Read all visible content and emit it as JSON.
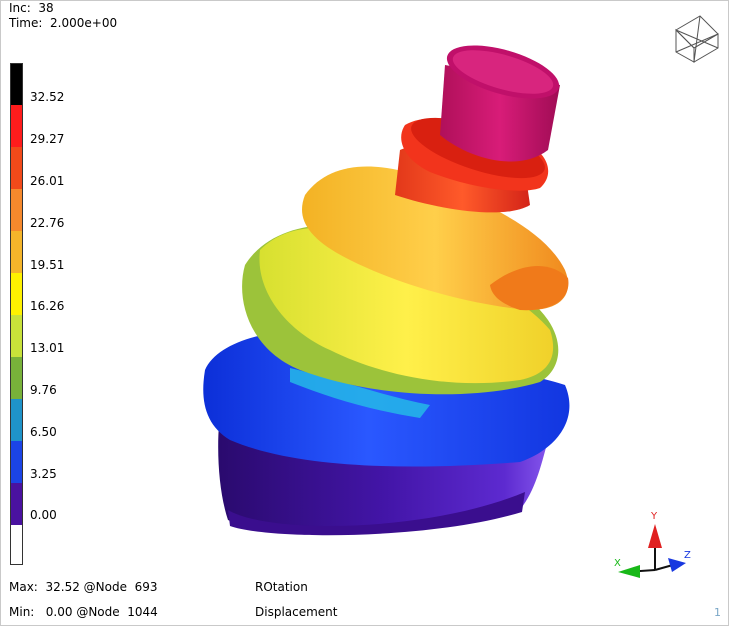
{
  "header": {
    "inc": "Inc:  38",
    "time": "Time:  2.000e+00"
  },
  "legend": {
    "ticks": [
      "32.52",
      "29.27",
      "26.01",
      "22.76",
      "19.51",
      "16.26",
      "13.01",
      "9.76",
      "6.50",
      "3.25",
      "0.00"
    ],
    "colors": [
      "#000000",
      "#ff1c1c",
      "#f24a1a",
      "#f6892c",
      "#f5b52a",
      "#fff200",
      "#c8e23a",
      "#78b23a",
      "#1f93c9",
      "#1b44e6",
      "#4a12a0",
      "#ffffff"
    ]
  },
  "footer": {
    "max": "Max:  32.52 @Node  693",
    "min": "Min:   0.00 @Node  1044",
    "label1": "ROtation",
    "label2": "Displacement",
    "page": "1"
  },
  "axes": {
    "x": "X",
    "y": "Y",
    "z": "Z"
  }
}
